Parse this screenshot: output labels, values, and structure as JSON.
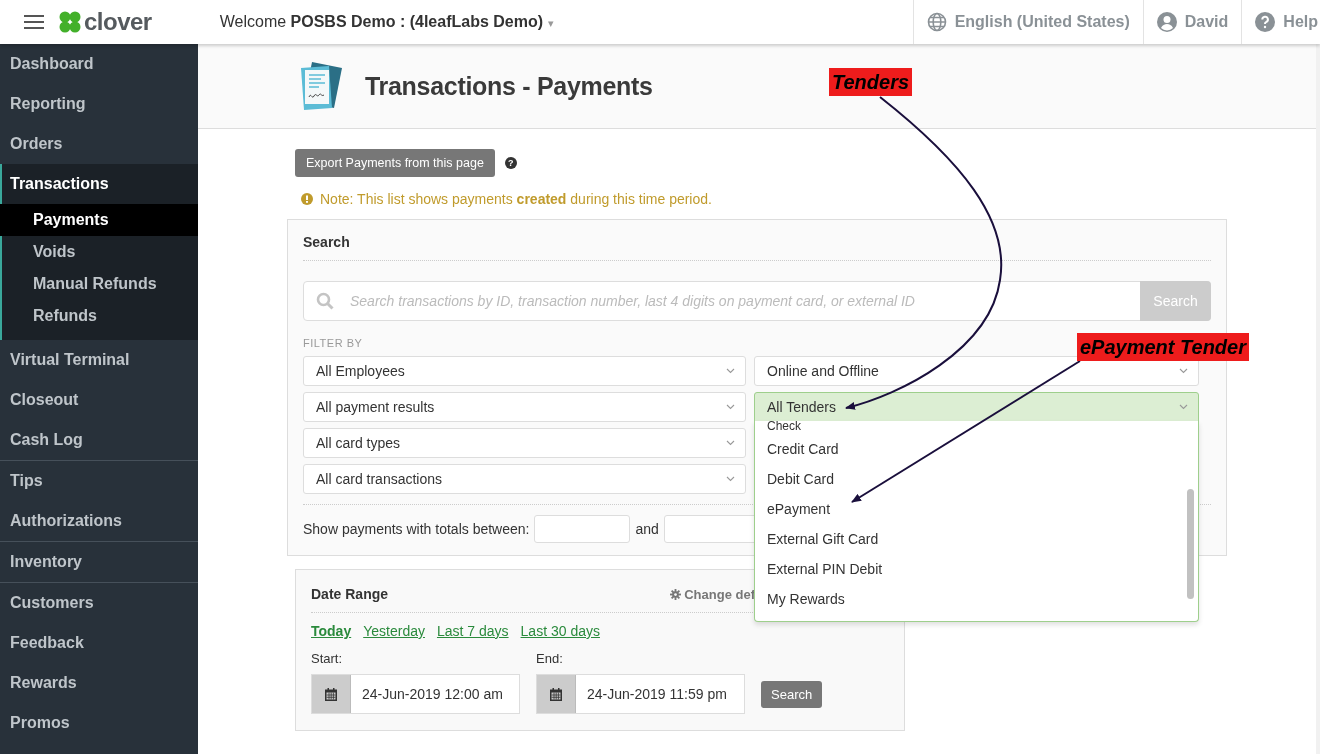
{
  "header": {
    "logo": "clover",
    "welcome": "Welcome **POSBS Demo : (4leafLabs Demo)**",
    "caret": "▾",
    "language": "English (United States)",
    "user": "David",
    "help": "Help"
  },
  "sidebar": {
    "groups": [
      [
        {
          "label": "Dashboard",
          "selected": false
        },
        {
          "label": "Reporting",
          "selected": false
        },
        {
          "label": "Orders",
          "selected": false
        },
        {
          "label": "Transactions",
          "selected": true,
          "expanded": true,
          "children": [
            {
              "label": "Payments",
              "selected": true
            },
            {
              "label": "Voids",
              "selected": false
            },
            {
              "label": "Manual Refunds",
              "selected": false
            },
            {
              "label": "Refunds",
              "selected": false
            }
          ]
        },
        {
          "label": "Virtual Terminal",
          "selected": false
        },
        {
          "label": "Closeout",
          "selected": false
        },
        {
          "label": "Cash Log",
          "selected": false
        }
      ],
      [
        {
          "label": "Tips",
          "selected": false
        },
        {
          "label": "Authorizations",
          "selected": false
        }
      ],
      [
        {
          "label": "Inventory",
          "selected": false
        }
      ],
      [
        {
          "label": "Customers",
          "selected": false
        },
        {
          "label": "Feedback",
          "selected": false
        },
        {
          "label": "Rewards",
          "selected": false
        },
        {
          "label": "Promos",
          "selected": false
        }
      ]
    ]
  },
  "page": {
    "title": "Transactions - Payments",
    "export_button": "Export Payments from this page",
    "help_mark": "?",
    "note": "Note: This list shows payments **created** during this time period."
  },
  "search": {
    "title": "Search",
    "placeholder": "Search transactions by ID, transaction number, last 4 digits on payment card, or external ID",
    "button": "Search",
    "filter_label": "FILTER BY",
    "filters_left": [
      {
        "value": "All Employees",
        "open": false
      },
      {
        "value": "All payment results",
        "open": false
      },
      {
        "value": "All card types",
        "open": false
      },
      {
        "value": "All card transactions",
        "open": false
      }
    ],
    "filters_right": [
      {
        "value": "Online and Offline",
        "open": false
      },
      {
        "value": "All Tenders",
        "open": true
      }
    ],
    "dropdown_options": [
      "Check",
      "Credit Card",
      "Debit Card",
      "ePayment",
      "External Gift Card",
      "External PIN Debit",
      "My Rewards"
    ],
    "totals_label": "Show payments with totals between:",
    "and_label": "and"
  },
  "date_range": {
    "title": "Date Range",
    "change_default": "Change def",
    "presets": [
      {
        "label": "Today",
        "selected": true
      },
      {
        "label": "Yesterday",
        "selected": false
      },
      {
        "label": "Last 7 days",
        "selected": false
      },
      {
        "label": "Last 30 days",
        "selected": false
      }
    ],
    "start_label": "Start:",
    "start_value": "24-Jun-2019 12:00 am",
    "end_label": "End:",
    "end_value": "24-Jun-2019 11:59 pm",
    "button": "Search"
  },
  "annotations": [
    {
      "label": "Tenders"
    },
    {
      "label": "ePayment Tender"
    }
  ]
}
